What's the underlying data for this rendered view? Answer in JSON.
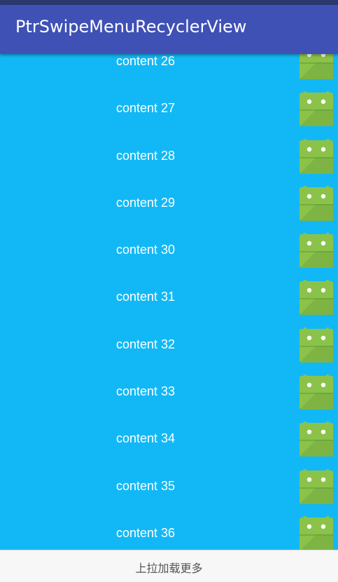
{
  "app": {
    "title": "PtrSwipeMenuRecyclerView"
  },
  "list": {
    "items": [
      {
        "label": "content 26",
        "icon": "android-icon"
      },
      {
        "label": "content 27",
        "icon": "android-icon"
      },
      {
        "label": "content 28",
        "icon": "android-icon"
      },
      {
        "label": "content 29",
        "icon": "android-icon"
      },
      {
        "label": "content 30",
        "icon": "android-icon"
      },
      {
        "label": "content 31",
        "icon": "android-icon"
      },
      {
        "label": "content 32",
        "icon": "android-icon"
      },
      {
        "label": "content 33",
        "icon": "android-icon"
      },
      {
        "label": "content 34",
        "icon": "android-icon"
      },
      {
        "label": "content 35",
        "icon": "android-icon"
      },
      {
        "label": "content 36",
        "icon": "android-icon"
      }
    ]
  },
  "footer": {
    "load_more_label": "上拉加载更多"
  },
  "colors": {
    "toolbar": "#3f51b5",
    "list_background": "#12b8f5",
    "android_green": "#8bc34a"
  }
}
